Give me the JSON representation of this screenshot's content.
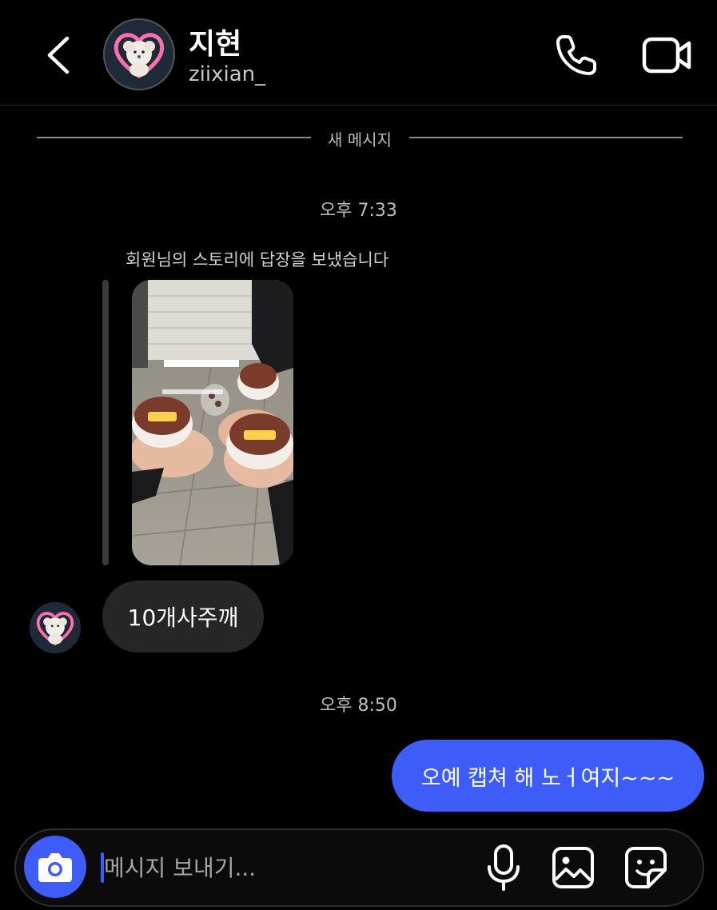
{
  "header": {
    "display_name": "지현",
    "username": "ziixian_",
    "icons": {
      "back": "chevron-left-icon",
      "call": "phone-icon",
      "video": "video-camera-icon"
    }
  },
  "divider": {
    "label": "새 메시지"
  },
  "thread": {
    "timestamp_1": "오후 7:33",
    "story_reply_label": "회원님의 스토리에 답장을 보냈습니다",
    "incoming_message": "10개사주깨",
    "timestamp_2": "오후 8:50",
    "outgoing_message": "오예 캡쳐 해 노ㅓ여지~~~"
  },
  "composer": {
    "placeholder": "메시지 보내기...",
    "icons": [
      "camera-icon",
      "microphone-icon",
      "gallery-icon",
      "sticker-icon"
    ]
  },
  "colors": {
    "accent": "#3d5cf8",
    "incoming_bubble": "#262626",
    "background": "#000000"
  }
}
